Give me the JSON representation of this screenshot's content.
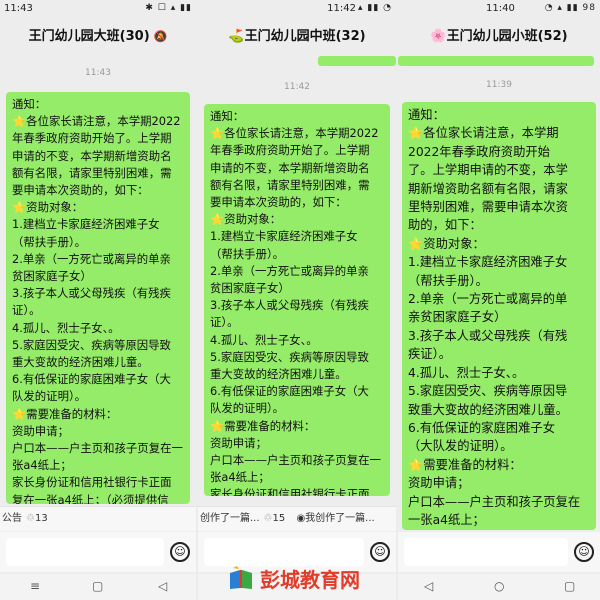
{
  "screens": [
    {
      "status_time": "11:43",
      "status_icons": "✱ ☐ ▴ ▮▮",
      "title": "王门幼儿园大班(30)",
      "mute_icon": "bell-off-icon",
      "timestamps": [
        "11:43"
      ],
      "message_lines": [
        "通知：",
        "⭐各位家长请注意，本学期2022",
        "年春季政府资助开始了。上学期",
        "申请的不变，本学期新增资助名",
        "额有名限，请家里特别困难，需",
        "要申请本次资助的，如下：",
        "⭐资助对象：",
        "1.建档立卡家庭经济困难子女",
        "（帮扶手册）。",
        "2.单亲（一方死亡或离异的单亲",
        "贫困家庭子女）",
        "3.孩子本人或父母残疾（有残疾",
        "证）。",
        "4.孤儿、烈士子女、。",
        "5.家庭因受灾、疾病等原因导致",
        "重大变故的经济困难儿童。",
        "6.有低保证的家庭困难子女（大",
        "队发的证明）。",
        "⭐需要准备的材料：",
        "资助申请；",
        "户口本——户主页和孩子页复在一",
        "张a4纸上；",
        "家长身份证和信用社银行卡正面",
        "复在一张a4纸上；（必须提供信"
      ],
      "notice": {
        "text": "公告",
        "count": "13"
      }
    },
    {
      "status_time": "11:42",
      "status_icons": "▴ ▮▮ ◔",
      "title": "⛳王门幼儿园中班(32)",
      "timestamps": [
        "11:42"
      ],
      "message_lines": [
        "通知：",
        "⭐各位家长请注意，本学期2022",
        "年春季政府资助开始了。上学期",
        "申请的不变，本学期新增资助名",
        "额有名限，请家里特别困难，需",
        "要申请本次资助的，如下：",
        "⭐资助对象：",
        "1.建档立卡家庭经济困难子女",
        "（帮扶手册）。",
        "2.单亲（一方死亡或离异的单亲",
        "贫困家庭子女）",
        "3.孩子本人或父母残疾（有残疾",
        "证）。",
        "4.孤儿、烈士子女、。",
        "5.家庭因受灾、疾病等原因导致",
        "重大变故的经济困难儿童。",
        "6.有低保证的家庭困难子女（大",
        "队发的证明）。",
        "⭐需要准备的材料：",
        "资助申请；",
        "户口本——户主页和孩子页复在一",
        "张a4纸上；",
        "家长身份证和信用社银行卡正面"
      ],
      "notice": {
        "text": "创作了一篇...",
        "count": "15",
        "text2": "我创作了一篇..."
      }
    },
    {
      "status_time": "11:40",
      "status_icons": "◔ ▴ ▮▮ 98",
      "title": "🌸王门幼儿园小班(52)",
      "timestamps": [
        "11:39"
      ],
      "message_lines": [
        "通知：",
        "⭐各位家长请注意，本学期",
        "2022年春季政府资助开始",
        "了。上学期申请的不变，本学",
        "期新增资助名额有名限，请家",
        "里特别困难，需要申请本次资",
        "助的，如下：",
        "⭐资助对象：",
        "1.建档立卡家庭经济困难子女",
        "（帮扶手册）。",
        "2.单亲（一方死亡或离异的单",
        "亲贫困家庭子女）",
        "3.孩子本人或父母残疾（有残",
        "疾证）。",
        "4.孤儿、烈士子女、。",
        "5.家庭因受灾、疾病等原因导",
        "致重大变故的经济困难儿童。",
        "6.有低保证的家庭困难子女",
        "（大队发的证明）。",
        "⭐需要准备的材料：",
        "资助申请；",
        "户口本——户主页和孩子页复在",
        "一张a4纸上；",
        "家长身份证和信用社银行卡正",
        "面复在一张a4纸上；（必须"
      ]
    }
  ],
  "nav_icons": [
    "≡",
    "▢",
    "◁"
  ],
  "watermark": {
    "text": "彭城教育网"
  },
  "colors": {
    "bubble_green": "#95ec69",
    "watermark_red": "#e33b2a"
  }
}
